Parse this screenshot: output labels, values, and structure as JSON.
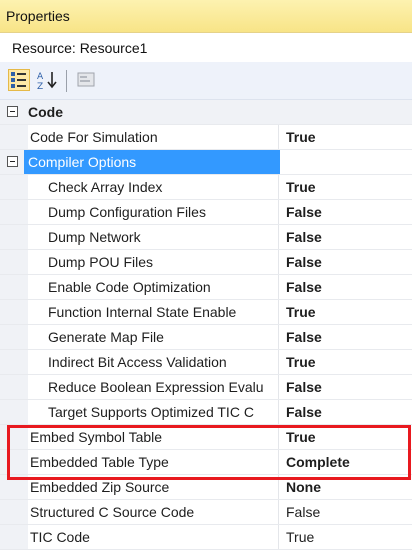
{
  "panel": {
    "title": "Properties",
    "resource_label": "Resource: Resource1"
  },
  "toolbar": {
    "buttons": [
      {
        "name": "categorized-view-icon",
        "active": true
      },
      {
        "name": "alphabetical-sort-icon",
        "active": false
      },
      {
        "name": "property-pages-icon",
        "active": false
      }
    ]
  },
  "categories": {
    "code": {
      "label": "Code",
      "expanded": true
    },
    "compiler_options": {
      "label": "Compiler Options",
      "expanded": true,
      "selected": true
    }
  },
  "properties": {
    "code_for_simulation": {
      "name": "Code For Simulation",
      "value": "True"
    },
    "check_array_index": {
      "name": "Check Array Index",
      "value": "True"
    },
    "dump_configuration_files": {
      "name": "Dump Configuration Files",
      "value": "False"
    },
    "dump_network": {
      "name": "Dump Network",
      "value": "False"
    },
    "dump_pou_files": {
      "name": "Dump POU Files",
      "value": "False"
    },
    "enable_code_optimization": {
      "name": "Enable Code Optimization",
      "value": "False"
    },
    "function_internal_state_enable": {
      "name": "Function Internal State Enable",
      "value": "True"
    },
    "generate_map_file": {
      "name": "Generate Map File",
      "value": "False"
    },
    "indirect_bit_access_validation": {
      "name": "Indirect Bit Access Validation",
      "value": "True"
    },
    "reduce_boolean_expression": {
      "name": "Reduce Boolean Expression Evalu",
      "value": "False"
    },
    "target_supports_optimized_tic": {
      "name": "Target Supports Optimized TIC C",
      "value": "False"
    },
    "embed_symbol_table": {
      "name": "Embed Symbol Table",
      "value": "True"
    },
    "embedded_table_type": {
      "name": "Embedded Table Type",
      "value": "Complete"
    },
    "embedded_zip_source": {
      "name": "Embedded Zip Source",
      "value": "None"
    },
    "structured_c_source_code": {
      "name": "Structured C Source Code",
      "value": "False"
    },
    "tic_code": {
      "name": "TIC Code",
      "value": "True"
    }
  },
  "colors": {
    "title_bar": "#f8e487",
    "selection": "#3399ff",
    "highlight_box": "#e8191f"
  }
}
